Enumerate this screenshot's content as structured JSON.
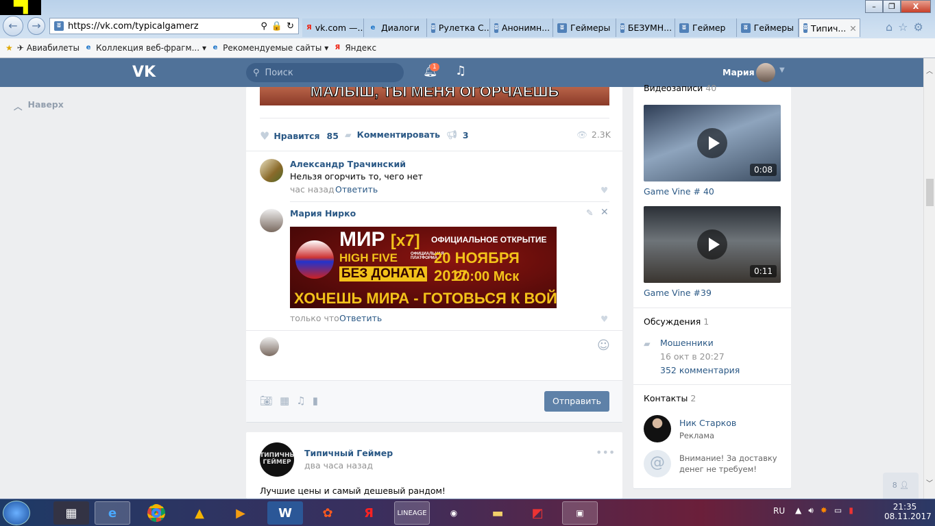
{
  "browser": {
    "url": "https://vk.com/typicalgamerz",
    "tabs": [
      {
        "label": "vk.com —...",
        "icon": "yandex-icon"
      },
      {
        "label": "Диалоги",
        "icon": "ie-icon"
      },
      {
        "label": "Рулетка С...",
        "icon": "vk-icon"
      },
      {
        "label": "Анонимн...",
        "icon": "vk-icon"
      },
      {
        "label": "Геймеры",
        "icon": "vk-icon"
      },
      {
        "label": "БЕЗУМН...",
        "icon": "vk-icon"
      },
      {
        "label": "Геймер",
        "icon": "vk-icon"
      },
      {
        "label": "Геймеры",
        "icon": "vk-icon"
      },
      {
        "label": "Типич...",
        "icon": "vk-icon",
        "active": true
      }
    ],
    "favorites": [
      {
        "label": "Авиабилеты"
      },
      {
        "label": "Коллекция веб-фрагм...",
        "dropdown": true
      },
      {
        "label": "Рекомендуемые сайты",
        "dropdown": true
      },
      {
        "label": "Яндекс"
      }
    ]
  },
  "vk_header": {
    "search_placeholder": "Поиск",
    "notifications_count": "1",
    "user_name": "Мария"
  },
  "left": {
    "back_to_top": "Наверх"
  },
  "post": {
    "image_caption": "МАЛЫШ, ТЫ МЕНЯ ОГОРЧАЕШЬ",
    "like_label": "Нравится",
    "like_count": "85",
    "comment_label": "Комментировать",
    "share_count": "3",
    "views": "2.3K",
    "comments": [
      {
        "author": "Александр Трачинский",
        "text": "Нельзя огорчить то, чего нет",
        "time": "час назад",
        "reply": "Ответить"
      },
      {
        "author": "Мария Нирко",
        "time": "только что",
        "reply": "Ответить",
        "banner": {
          "title": "МИР",
          "x": "[x7]",
          "sub": "HIGH FIVE",
          "sub2": "ОФИЦИАЛЬНАЯ ПЛАТФОРМА",
          "nodonate": "БЕЗ ДОНАТА",
          "opening": "ОФИЦИАЛЬНОЕ ОТКРЫТИЕ",
          "date": "20 НОЯБРЯ 2017",
          "time": "20:00 Мск",
          "slogan": "ХОЧЕШЬ МИРА - ГОТОВЬСЯ К ВОЙНЕ"
        }
      }
    ],
    "send_button": "Отправить"
  },
  "post2": {
    "author": "Типичный Геймер",
    "time": "два часа назад",
    "text": "Лучшие цены и самый дешевый рандом!"
  },
  "right": {
    "videos_title": "Видеозаписи",
    "videos_count": "40",
    "videos": [
      {
        "title": "Game Vine # 40",
        "duration": "0:08"
      },
      {
        "title": "Game Vine #39",
        "duration": "0:11"
      }
    ],
    "discussions_title": "Обсуждения",
    "discussions_count": "1",
    "discussion": {
      "title": "Мошенники",
      "date": "16 окт в 20:27",
      "comments": "352 комментария"
    },
    "contacts_title": "Контакты",
    "contacts_count": "2",
    "contacts": [
      {
        "name": "Ник Старков",
        "role": "Реклама"
      },
      {
        "role": "Внимание! За доставку денег не требуем!"
      }
    ],
    "friends_online": "8"
  },
  "taskbar": {
    "lang": "RU",
    "time": "21:35",
    "date": "08.11.2017"
  }
}
